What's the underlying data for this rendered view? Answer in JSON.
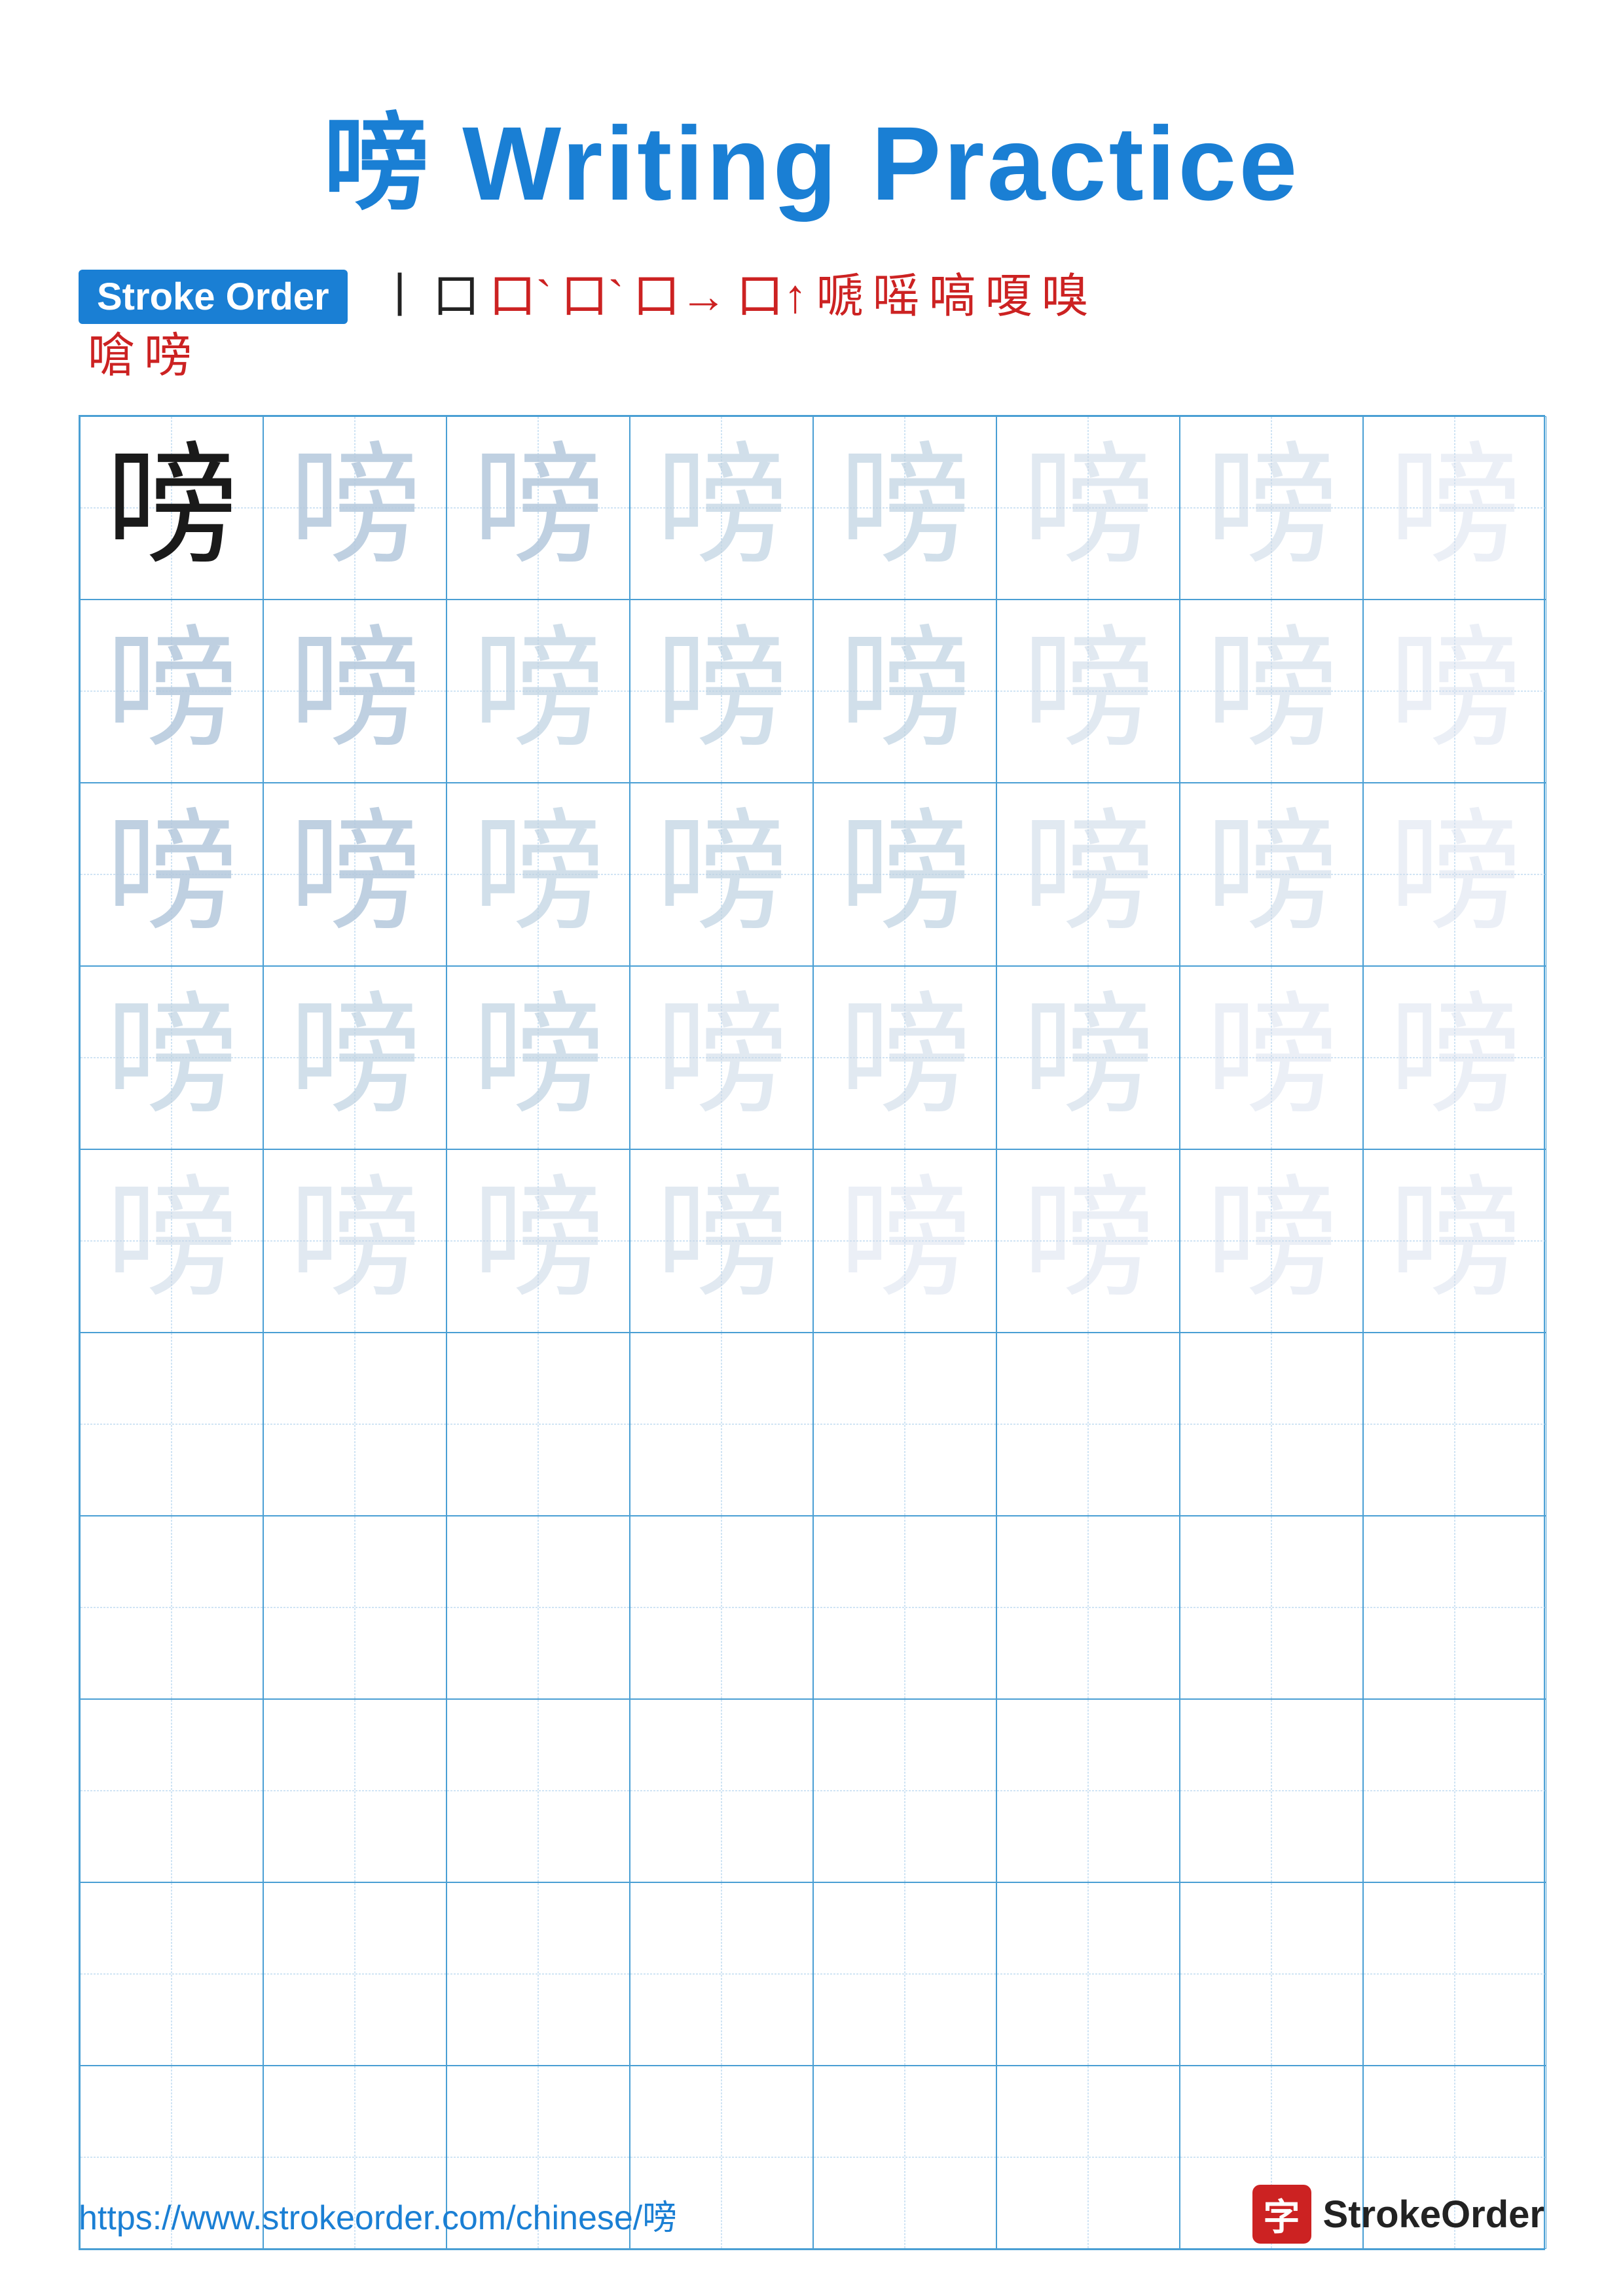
{
  "page": {
    "title": "嗙 Writing Practice",
    "title_char": "嗙",
    "title_text": "Writing Practice",
    "stroke_order_label": "Stroke Order",
    "stroke_chars_line1": [
      "丨",
      "口",
      "口`",
      "口`",
      "口→",
      "口↑",
      "嗁",
      "嗂",
      "嗃",
      "嗄",
      "嗅"
    ],
    "stroke_chars_line2": [
      "嗆",
      "嗙"
    ],
    "practice_char": "嗙",
    "footer_url": "https://www.strokeorder.com/chinese/嗙",
    "footer_brand": "StrokeOrder",
    "footer_logo_char": "字"
  }
}
